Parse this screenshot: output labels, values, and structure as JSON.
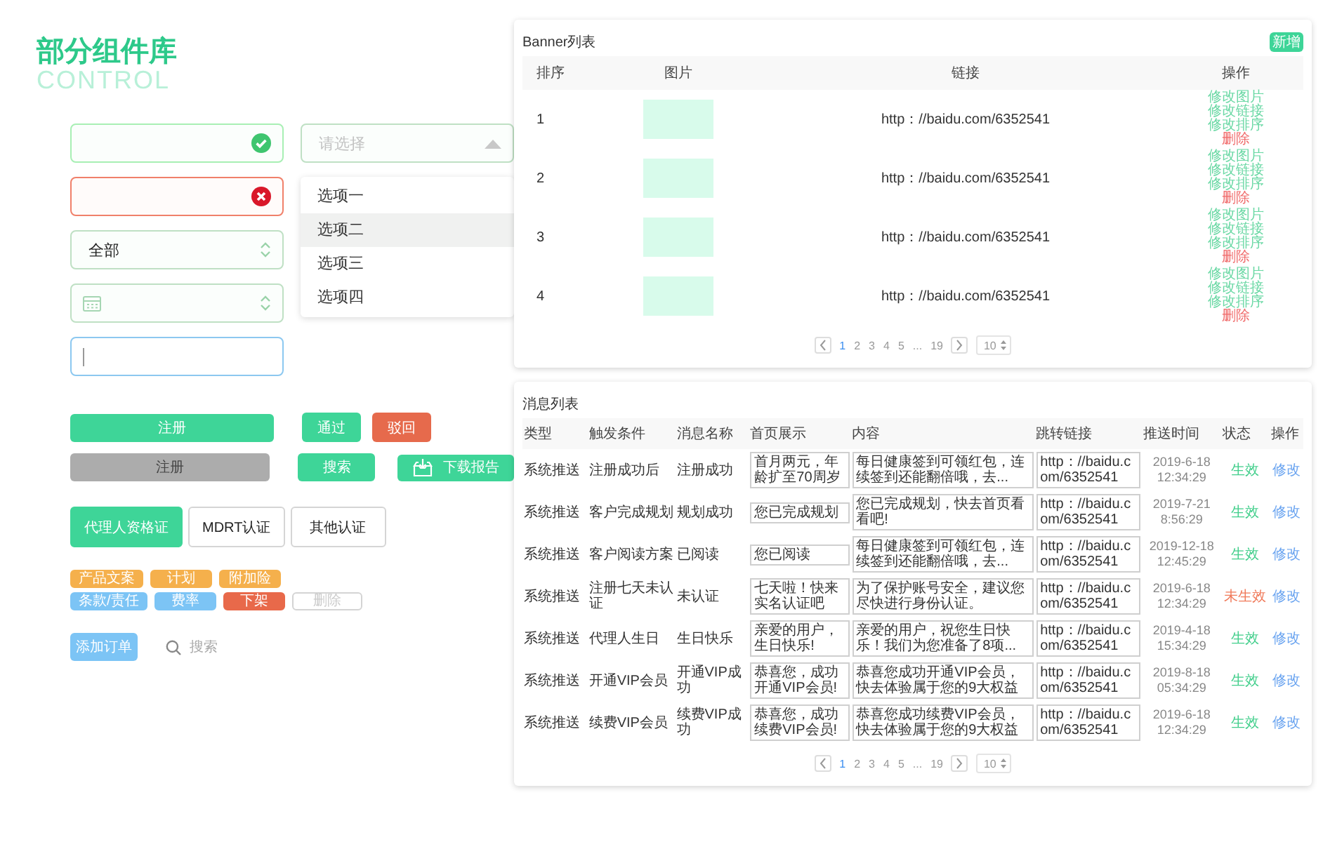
{
  "header": {
    "title": "部分组件库",
    "subtitle": "CONTROL"
  },
  "fields": [
    {
      "kind": "success"
    },
    {
      "kind": "error"
    },
    {
      "kind": "select",
      "value": "全部"
    },
    {
      "kind": "date"
    },
    {
      "kind": "focused"
    }
  ],
  "dropdown": {
    "placeholder": "请选择",
    "expanded": true,
    "options": [
      {
        "label": "选项一",
        "selected": false
      },
      {
        "label": "选项二",
        "selected": true
      },
      {
        "label": "选项三",
        "selected": false
      },
      {
        "label": "选项四",
        "selected": false
      }
    ]
  },
  "button_rows": [
    [
      {
        "label": "注册",
        "kind": "wide"
      },
      {
        "label": "通过",
        "kind": "approve"
      },
      {
        "label": "驳回",
        "kind": "reject"
      }
    ],
    [
      {
        "label": "注册",
        "kind": "wide-disabled"
      },
      {
        "label": "搜索",
        "kind": "search"
      },
      {
        "label": "下载报告",
        "kind": "download"
      }
    ]
  ],
  "cert_tabs": [
    {
      "label": "代理人资格证",
      "selected": true
    },
    {
      "label": "MDRT认证",
      "selected": false
    },
    {
      "label": "其他认证",
      "selected": false
    }
  ],
  "tag_rows": [
    [
      {
        "label": "产品文案",
        "kind": "filled",
        "color": "#f5b04c"
      },
      {
        "label": "计划",
        "kind": "filled",
        "color": "#f5b04c"
      },
      {
        "label": "附加险",
        "kind": "filled",
        "color": "#f5b04c"
      }
    ],
    [
      {
        "label": "条款/责任",
        "kind": "filled",
        "color": "#7cc4f5"
      },
      {
        "label": "费率",
        "kind": "filled",
        "color": "#7cc4f5"
      },
      {
        "label": "下架",
        "kind": "filled",
        "color": "#e8694a"
      },
      {
        "label": "删除",
        "kind": "outline",
        "color": "#d4d4d4"
      }
    ]
  ],
  "add_order": {
    "label": "添加订单"
  },
  "search": {
    "placeholder": "搜索"
  },
  "banner_panel": {
    "title": "Banner列表",
    "add_button": "新增",
    "columns": [
      "排序",
      "图片",
      "链接",
      "操作"
    ],
    "rows": [
      {
        "index": "1",
        "link": "http：//baidu.com/6352541",
        "actions": [
          {
            "label": "修改图片",
            "kind": "edit"
          },
          {
            "label": "修改链接",
            "kind": "edit"
          },
          {
            "label": "修改排序",
            "kind": "edit"
          },
          {
            "label": "删除",
            "kind": "delete"
          }
        ]
      },
      {
        "index": "2",
        "link": "http：//baidu.com/6352541",
        "actions": [
          {
            "label": "修改图片",
            "kind": "edit"
          },
          {
            "label": "修改链接",
            "kind": "edit"
          },
          {
            "label": "修改排序",
            "kind": "edit"
          },
          {
            "label": "删除",
            "kind": "delete"
          }
        ]
      },
      {
        "index": "3",
        "link": "http：//baidu.com/6352541",
        "actions": [
          {
            "label": "修改图片",
            "kind": "edit"
          },
          {
            "label": "修改链接",
            "kind": "edit"
          },
          {
            "label": "修改排序",
            "kind": "edit"
          },
          {
            "label": "删除",
            "kind": "delete"
          }
        ]
      },
      {
        "index": "4",
        "link": "http：//baidu.com/6352541",
        "actions": [
          {
            "label": "修改图片",
            "kind": "edit"
          },
          {
            "label": "修改链接",
            "kind": "edit"
          },
          {
            "label": "修改排序",
            "kind": "edit"
          },
          {
            "label": "删除",
            "kind": "delete"
          }
        ]
      }
    ],
    "pagination": {
      "pages": [
        {
          "label": "1",
          "selected": true
        },
        {
          "label": "2",
          "selected": false
        },
        {
          "label": "3",
          "selected": false
        },
        {
          "label": "4",
          "selected": false
        },
        {
          "label": "5",
          "selected": false
        },
        {
          "label": "...",
          "selected": false
        },
        {
          "label": "19",
          "selected": false
        }
      ],
      "page_size": "10"
    }
  },
  "message_panel": {
    "title": "消息列表",
    "columns": [
      "类型",
      "触发条件",
      "消息名称",
      "首页展示",
      "内容",
      "跳转链接",
      "推送时间",
      "状态",
      "操作"
    ],
    "rows": [
      {
        "type": "系统推送",
        "trigger": "注册成功后",
        "name": "注册成功",
        "preview": "首月两元，年龄扩至70周岁",
        "content": "每日健康签到可领红包，连续签到还能翻倍哦，去...",
        "link": "http：//baidu.com/6352541",
        "time": "2019-6-18 12:34:29",
        "status": {
          "label": "生效",
          "kind": "active"
        },
        "action": "修改"
      },
      {
        "type": "系统推送",
        "trigger": "客户完成规划",
        "name": "规划成功",
        "preview": "您已完成规划",
        "content": "您已完成规划，快去首页看看吧!",
        "link": "http：//baidu.com/6352541",
        "time": "2019-7-21 8:56:29",
        "status": {
          "label": "生效",
          "kind": "active"
        },
        "action": "修改"
      },
      {
        "type": "系统推送",
        "trigger": "客户阅读方案",
        "name": "已阅读",
        "preview": "您已阅读",
        "content": "每日健康签到可领红包，连续签到还能翻倍哦，去...",
        "link": "http：//baidu.com/6352541",
        "time": "2019-12-18 12:45:29",
        "status": {
          "label": "生效",
          "kind": "active"
        },
        "action": "修改"
      },
      {
        "type": "系统推送",
        "trigger": "注册七天未认证",
        "name": "未认证",
        "preview": "七天啦！快来实名认证吧",
        "content": "为了保护账号安全，建议您尽快进行身份认证。",
        "link": "http：//baidu.com/6352541",
        "time": "2019-6-18 12:34:29",
        "status": {
          "label": "未生效",
          "kind": "inactive"
        },
        "action": "修改"
      },
      {
        "type": "系统推送",
        "trigger": "代理人生日",
        "name": "生日快乐",
        "preview": "亲爱的用户，生日快乐!",
        "content": "亲爱的用户，祝您生日快乐！我们为您准备了8项...",
        "link": "http：//baidu.com/6352541",
        "time": "2019-4-18 15:34:29",
        "status": {
          "label": "生效",
          "kind": "active"
        },
        "action": "修改"
      },
      {
        "type": "系统推送",
        "trigger": "开通VIP会员",
        "name": "开通VIP成功",
        "preview": "恭喜您，成功开通VIP会员!",
        "content": "恭喜您成功开通VIP会员，快去体验属于您的9大权益",
        "link": "http：//baidu.com/6352541",
        "time": "2019-8-18 05:34:29",
        "status": {
          "label": "生效",
          "kind": "active"
        },
        "action": "修改"
      },
      {
        "type": "系统推送",
        "trigger": "续费VIP会员",
        "name": "续费VIP成功",
        "preview": "恭喜您，成功续费VIP会员!",
        "content": "恭喜您成功续费VIP会员，快去体验属于您的9大权益",
        "link": "http：//baidu.com/6352541",
        "time": "2019-6-18 12:34:29",
        "status": {
          "label": "生效",
          "kind": "active"
        },
        "action": "修改"
      }
    ],
    "pagination": {
      "pages": [
        {
          "label": "1",
          "selected": true
        },
        {
          "label": "2",
          "selected": false
        },
        {
          "label": "3",
          "selected": false
        },
        {
          "label": "4",
          "selected": false
        },
        {
          "label": "5",
          "selected": false
        },
        {
          "label": "...",
          "selected": false
        },
        {
          "label": "19",
          "selected": false
        }
      ],
      "page_size": "10"
    }
  }
}
